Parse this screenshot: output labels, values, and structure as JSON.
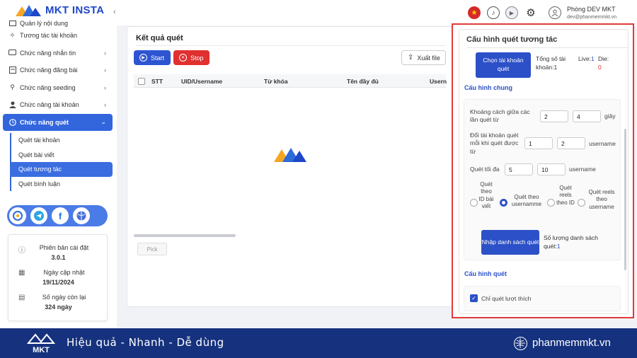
{
  "app": {
    "name": "MKT INSTA"
  },
  "sidebar": {
    "items": [
      {
        "label": "Quản lý nội dung",
        "icon": "folder-icon",
        "chevron": false
      },
      {
        "label": "Tương tác tài khoản",
        "icon": "sparkle-icon",
        "chevron": false
      },
      {
        "label": "Chức năng nhắn tin",
        "icon": "message-icon",
        "chevron": true
      },
      {
        "label": "Chức năng đăng bài",
        "icon": "post-icon",
        "chevron": true
      },
      {
        "label": "Chức năng seeding",
        "icon": "seeding-icon",
        "chevron": true
      },
      {
        "label": "Chức năng tài khoản",
        "icon": "user-icon",
        "chevron": true
      },
      {
        "label": "Chức năng quét",
        "icon": "clock-icon",
        "chevron": true,
        "active": true
      }
    ],
    "sub_items": [
      {
        "label": "Quét tài khoản"
      },
      {
        "label": "Quét bài viết"
      },
      {
        "label": "Quét tương tác",
        "active": true
      },
      {
        "label": "Quét bình luận"
      }
    ],
    "social": [
      "support-icon",
      "telegram-icon",
      "facebook-icon",
      "globe-icon"
    ],
    "info": {
      "version_label": "Phiên bản cài đặt",
      "version": "3.0.1",
      "update_label": "Ngày cập nhật",
      "update_date": "19/11/2024",
      "days_label": "Số ngày còn lại",
      "days": "324 ngày"
    }
  },
  "topbar": {
    "user_name": "Phòng DEV MKT",
    "user_email": "dev@phanmemmkt.vn"
  },
  "results": {
    "title": "Kết quả quét",
    "start_label": "Start",
    "stop_label": "Stop",
    "export_label": "Xuất file",
    "columns": [
      "STT",
      "UID/Username",
      "Từ khóa",
      "Tên đầy đủ",
      "Usern"
    ],
    "pick_label": "Pick"
  },
  "config": {
    "title": "Cấu hình quét tương tác",
    "select_account_label": "Chọn tài khoản quét",
    "total_accounts_label": "Tổng số tài khoản:",
    "total_accounts": "1",
    "live_label": "Live:",
    "live": "1",
    "die_label": "Die:",
    "die": "0",
    "general_section": "Cấu hình chung",
    "interval_label": "Khoảng cách giữa các lần quét từ",
    "interval_from": "2",
    "interval_to": "4",
    "interval_unit": "giây",
    "switch_label": "Đổi tài khoản quét mỗi khi quét được từ",
    "switch_from": "1",
    "switch_to": "2",
    "switch_unit": "username",
    "max_label": "Quét tối đa",
    "max_from": "5",
    "max_to": "10",
    "max_unit": "username",
    "radio_options": [
      {
        "label": "Quét theo ID bài viết",
        "selected": false
      },
      {
        "label": "Quét theo usernamme",
        "selected": true
      },
      {
        "label": "Quét reels theo ID",
        "selected": false
      },
      {
        "label": "Quét reels theo username",
        "selected": false
      }
    ],
    "import_label": "Nhập danh sách quét",
    "list_count_label": "Số lượng danh sách quét:",
    "list_count": "1",
    "scan_section": "Cấu hình quét",
    "only_like_label": "Chỉ quét lượt thích",
    "only_like_checked": true
  },
  "footer": {
    "logo_text": "MKT",
    "slogan": "Hiệu quả - Nhanh - Dễ dùng",
    "site": "phanmemmkt.vn"
  },
  "colors": {
    "brand": "#2c50c8",
    "danger": "#e03030",
    "footer": "#16327e",
    "highlight": "#e23a3a"
  }
}
